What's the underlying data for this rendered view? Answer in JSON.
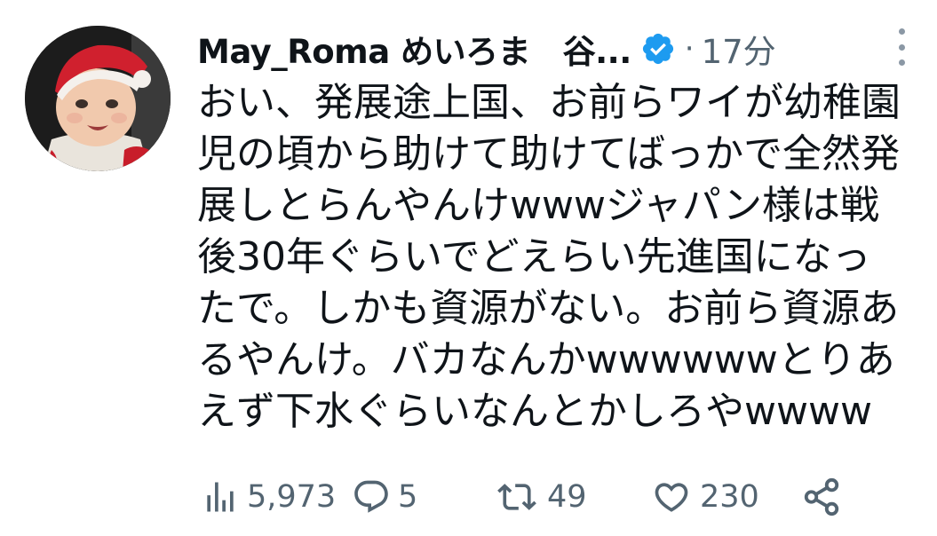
{
  "tweet": {
    "display_name": "May_Roma めいろま　谷...",
    "dot": "·",
    "time": "17分",
    "text_lines": [
      "おい、発展途上国、お前らワイが幼稚園",
      "児の頃から助けて助けてばっかで全然発",
      "展しとらんやんけwwwジャパン様は戦",
      "後30年ぐらいでどえらい先進国になっ",
      "たで。しかも資源がない。お前ら資源あ",
      "るやんけ。バカなんかwwwwwwとりあ",
      "えず下水ぐらいなんとかしろやwwww"
    ]
  },
  "actions": {
    "views": "5,973",
    "replies": "5",
    "retweets": "49",
    "likes": "230"
  },
  "colors": {
    "verified": "#1d9bf0",
    "muted": "#536471",
    "text": "#0f1419"
  },
  "icons": [
    "avatar",
    "verified-badge-icon",
    "more-icon",
    "views-icon",
    "reply-icon",
    "retweet-icon",
    "like-icon",
    "share-icon"
  ]
}
